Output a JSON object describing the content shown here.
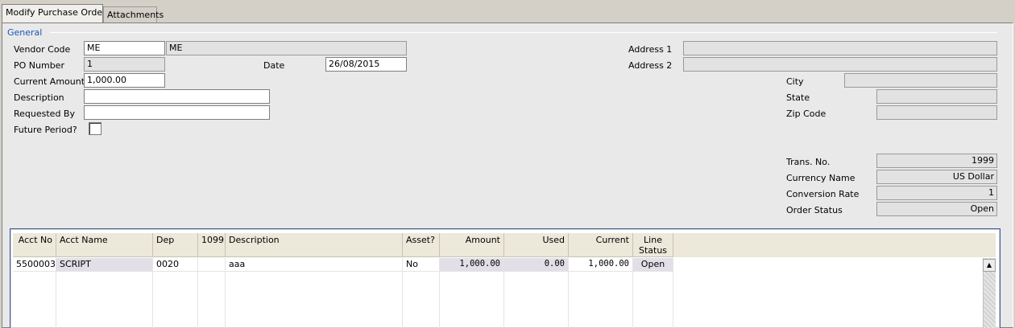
{
  "tabs": [
    "Modify Purchase Orders",
    "Attachments"
  ],
  "group_title": "General",
  "fields": {
    "vendor_code_label": "Vendor Code",
    "vendor_code": "ME",
    "vendor_name": "ME",
    "po_number_label": "PO Number",
    "po_number": "1",
    "date_label": "Date",
    "date": "26/08/2015",
    "current_amount_label": "Current Amount",
    "current_amount": "1,000.00",
    "description_label": "Description",
    "description": "",
    "requested_by_label": "Requested By",
    "requested_by": "",
    "future_period_label": "Future Period?",
    "address1_label": "Address 1",
    "address1": "",
    "address2_label": "Address 2",
    "address2": "",
    "city_label": "City",
    "city": "",
    "state_label": "State",
    "state": "",
    "zip_label": "Zip Code",
    "zip": "",
    "trans_no_label": "Trans. No.",
    "trans_no": "1999",
    "currency_name_label": "Currency Name",
    "currency_name": "US Dollar",
    "conversion_rate_label": "Conversion Rate",
    "conversion_rate": "1",
    "order_status_label": "Order Status",
    "order_status": "Open"
  },
  "grid": {
    "columns": [
      "Acct No",
      "Acct Name",
      "Dep",
      "1099",
      "Description",
      "Asset?",
      "Amount",
      "Used",
      "Current",
      "Line\nStatus"
    ],
    "rows": [
      [
        "5500003",
        "SCRIPT",
        "0020",
        "",
        "aaa",
        "No",
        "1,000.00",
        "0.00",
        "1,000.00",
        "Open"
      ]
    ]
  },
  "icons": {
    "scroll_up": "triangle-up-icon"
  }
}
